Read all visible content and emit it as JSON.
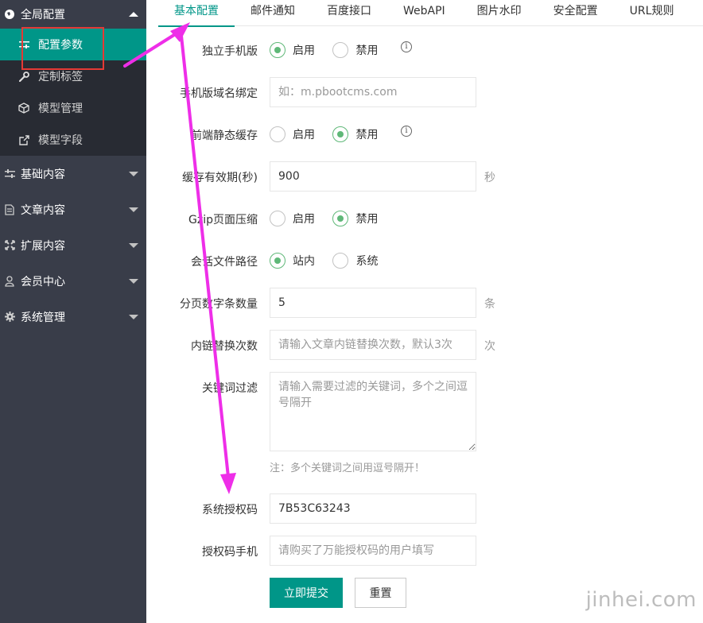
{
  "sidebar": {
    "global": {
      "label": "全局配置",
      "icon": "globe-icon"
    },
    "global_items": [
      {
        "label": "配置参数",
        "icon": "sliders-icon"
      },
      {
        "label": "定制标签",
        "icon": "wrench-icon"
      },
      {
        "label": "模型管理",
        "icon": "cube-icon"
      },
      {
        "label": "模型字段",
        "icon": "external-link-icon"
      }
    ],
    "groups": [
      {
        "label": "基础内容",
        "icon": "sliders-icon"
      },
      {
        "label": "文章内容",
        "icon": "document-icon"
      },
      {
        "label": "扩展内容",
        "icon": "expand-icon"
      },
      {
        "label": "会员中心",
        "icon": "user-icon"
      },
      {
        "label": "系统管理",
        "icon": "gear-icon"
      }
    ]
  },
  "tabs": [
    "基本配置",
    "邮件通知",
    "百度接口",
    "WebAPI",
    "图片水印",
    "安全配置",
    "URL规则"
  ],
  "form": {
    "wap": {
      "label": "独立手机版",
      "opt_on": "启用",
      "opt_off": "禁用",
      "selected": "启用"
    },
    "wap_domain": {
      "label": "手机版域名绑定",
      "placeholder": "如：m.pbootcms.com"
    },
    "tpl_html_cache": {
      "label": "前端静态缓存",
      "opt_on": "启用",
      "opt_off": "禁用",
      "selected": "禁用"
    },
    "cache_time": {
      "label": "缓存有效期(秒)",
      "value": "900",
      "unit": "秒"
    },
    "gzip": {
      "label": "Gzip页面压缩",
      "opt_on": "启用",
      "opt_off": "禁用",
      "selected": "禁用"
    },
    "session_path": {
      "label": "会话文件路径",
      "opt_on": "站内",
      "opt_off": "系统",
      "selected": "站内"
    },
    "page_num": {
      "label": "分页数字条数量",
      "value": "5",
      "unit": "条"
    },
    "link_times": {
      "label": "内链替换次数",
      "placeholder": "请输入文章内链替换次数，默认3次",
      "unit": "次"
    },
    "keyword_filter": {
      "label": "关键词过滤",
      "placeholder": "请输入需要过滤的关键词，多个之间逗号隔开",
      "hint": "注：多个关键词之间用逗号隔开！"
    },
    "sn": {
      "label": "系统授权码",
      "value": "7B53C63243"
    },
    "sn_user": {
      "label": "授权码手机",
      "placeholder": "请购买了万能授权码的用户填写"
    }
  },
  "buttons": {
    "submit": "立即提交",
    "reset": "重置"
  },
  "info_glyph": "i",
  "watermark": "jinhei.com",
  "colors": {
    "sidebar_bg": "#393d49",
    "accent": "#009688",
    "radio_on": "#5fb878",
    "annotation": "#ee2ee8",
    "highlight_box": "#e53935"
  }
}
